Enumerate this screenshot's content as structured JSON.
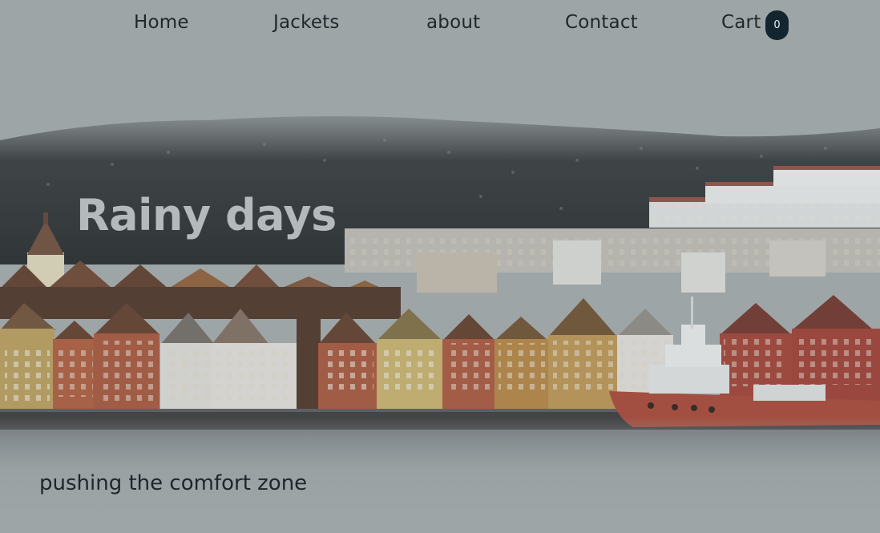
{
  "nav": {
    "items": [
      {
        "label": "Home"
      },
      {
        "label": "Jackets"
      },
      {
        "label": "about"
      },
      {
        "label": "Contact"
      }
    ],
    "cart_label": "Cart",
    "cart_count": "0"
  },
  "hero": {
    "title": "Rainy days",
    "tagline": "pushing the comfort zone"
  },
  "colors": {
    "overlay": "#9fa6a8",
    "badge": "#13252e",
    "nav_text": "#1f272b",
    "title_text": "#b4b9bb"
  }
}
